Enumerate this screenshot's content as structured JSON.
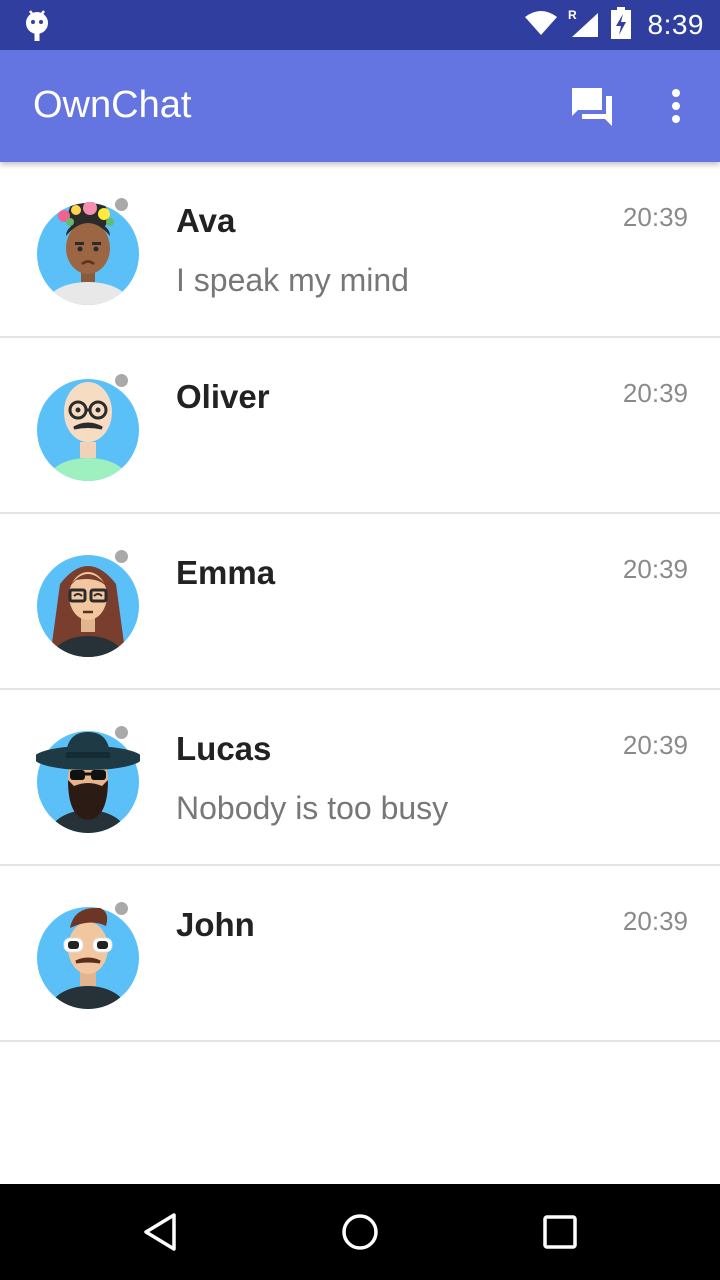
{
  "status_bar": {
    "time": "8:39",
    "icons": [
      "android-debug-icon",
      "wifi-icon",
      "signal-roaming-icon",
      "battery-charging-icon"
    ]
  },
  "app_bar": {
    "title": "OwnChat",
    "actions": [
      "chat-icon",
      "more-vert-icon"
    ],
    "color": "#6474E0"
  },
  "chats": [
    {
      "name": "Ava",
      "message": "I speak my mind",
      "time": "20:39",
      "avatar": "ava-avatar"
    },
    {
      "name": "Oliver",
      "message": "",
      "time": "20:39",
      "avatar": "oliver-avatar"
    },
    {
      "name": "Emma",
      "message": "",
      "time": "20:39",
      "avatar": "emma-avatar"
    },
    {
      "name": "Lucas",
      "message": "Nobody is too busy",
      "time": "20:39",
      "avatar": "lucas-avatar"
    },
    {
      "name": "John",
      "message": "",
      "time": "20:39",
      "avatar": "john-avatar"
    }
  ],
  "nav_bar": {
    "buttons": [
      "back-icon",
      "home-icon",
      "recents-icon"
    ]
  },
  "colors": {
    "status_bar": "#303F9F",
    "presence_dot": "#A9A9A9",
    "avatar_background": "#5BC0F8"
  }
}
